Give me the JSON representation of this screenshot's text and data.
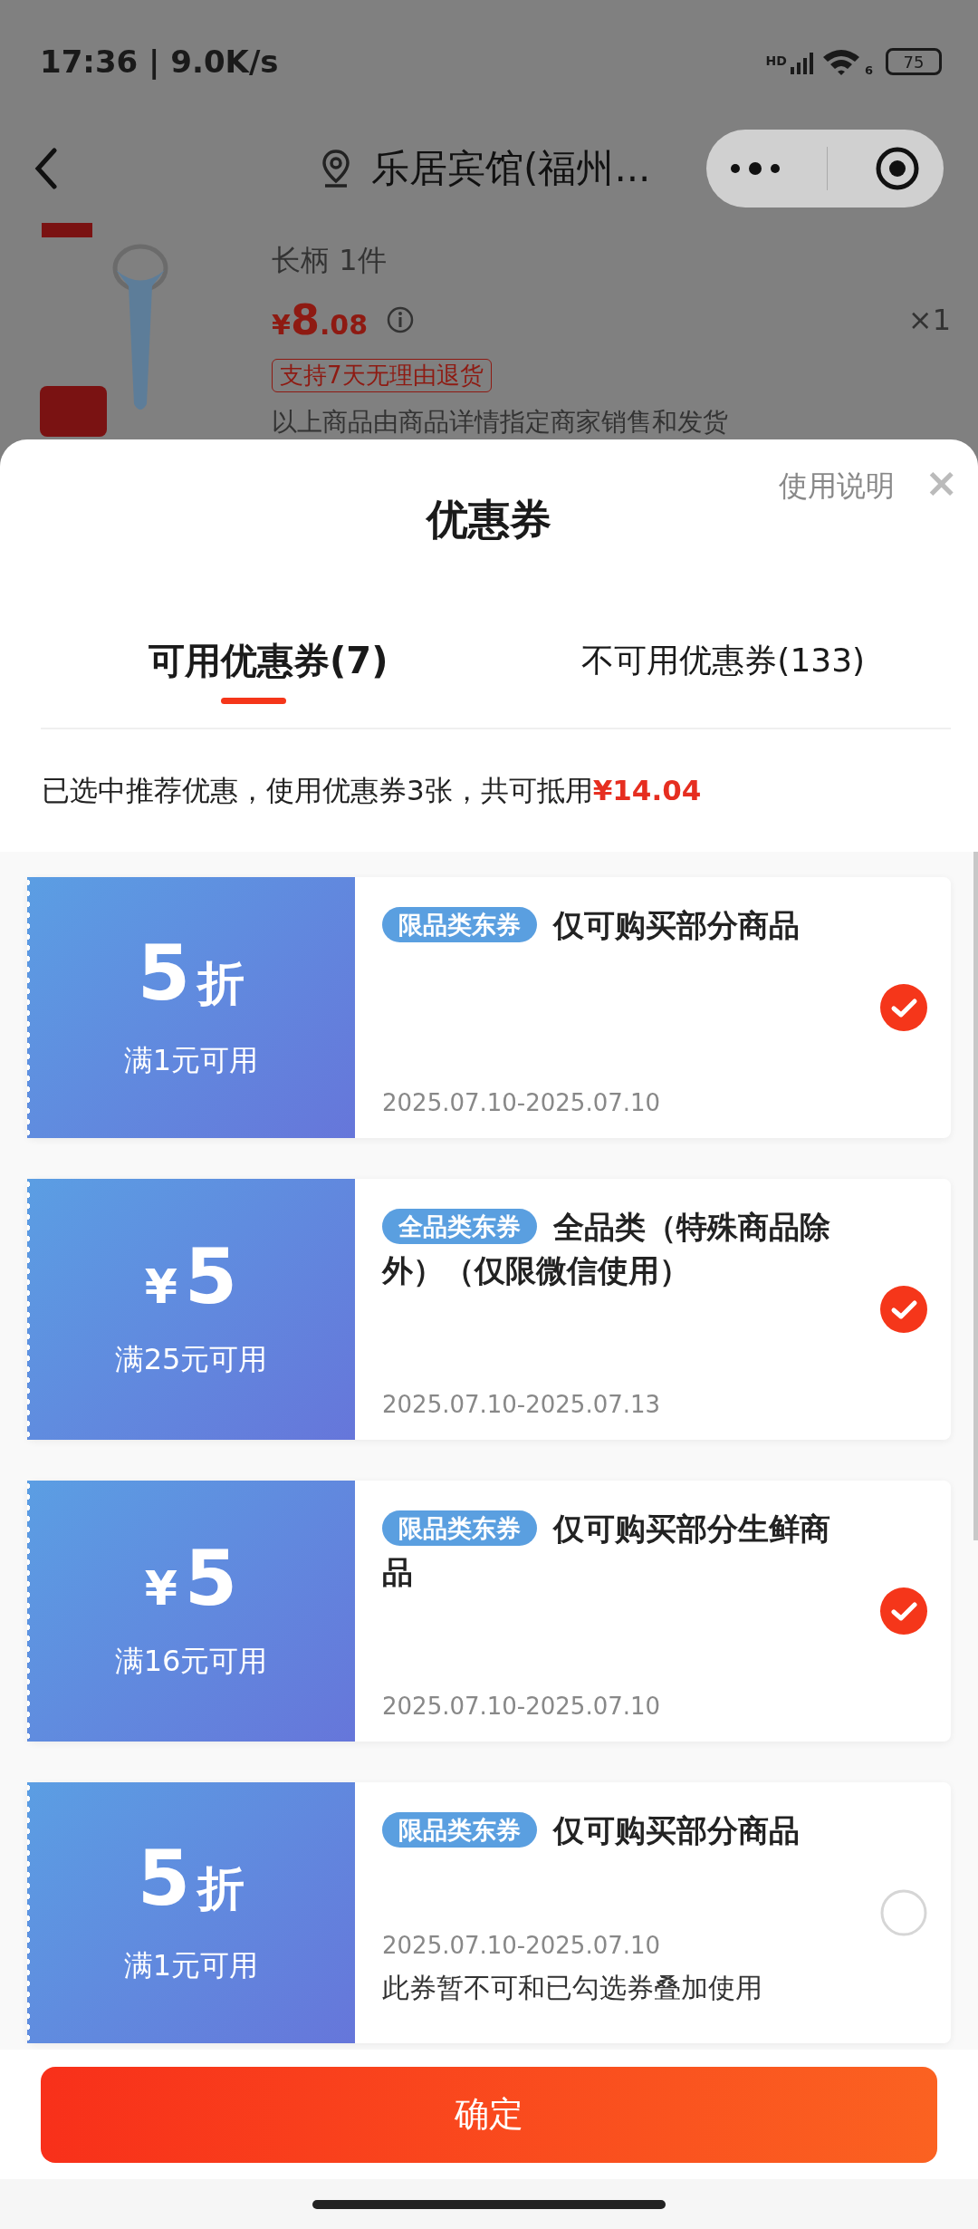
{
  "status_bar": {
    "time": "17:36 | 9.0K/s",
    "network": "HD",
    "wifi": "6",
    "battery": "75"
  },
  "nav": {
    "title": "乐居宾馆(福州..."
  },
  "product": {
    "spec": "长柄 1件",
    "price_symbol": "¥",
    "price_int": "8",
    "price_dec": ".08",
    "quantity": "×1",
    "return_tag": "支持7天无理由退货",
    "note": "以上商品由商品详情指定商家销售和发货"
  },
  "sheet": {
    "title": "优惠券",
    "help_link": "使用说明",
    "close": "×"
  },
  "tabs": [
    {
      "label": "可用优惠券(7)",
      "selected": true
    },
    {
      "label": "不可用优惠券(133)",
      "selected": false
    }
  ],
  "summary": "已选中推荐优惠，使用优惠券3张，共可抵用**¥14.04**",
  "coupons": [
    {
      "kind": "discount",
      "value": "5",
      "unit": "折",
      "condition": "满1元可用",
      "tag": "限品类东券",
      "title": "仅可购买部分商品",
      "date": "2025.07.10-2025.07.10",
      "selected": true
    },
    {
      "kind": "cash",
      "value": "5",
      "unit": "¥",
      "condition": "满25元可用",
      "tag": "全品类东券",
      "title": "全品类（特殊商品除外）（仅限微信使用）",
      "date": "2025.07.10-2025.07.13",
      "selected": true
    },
    {
      "kind": "cash",
      "value": "5",
      "unit": "¥",
      "condition": "满16元可用",
      "tag": "限品类东券",
      "title": "仅可购买部分生鲜商品",
      "date": "2025.07.10-2025.07.10",
      "selected": true
    },
    {
      "kind": "discount",
      "value": "5",
      "unit": "折",
      "condition": "满1元可用",
      "tag": "限品类东券",
      "title": "仅可购买部分商品",
      "date": "2025.07.10-2025.07.10",
      "note": "此券暂不可和已勾选券叠加使用",
      "selected": false
    }
  ],
  "confirm_button": "确定"
}
